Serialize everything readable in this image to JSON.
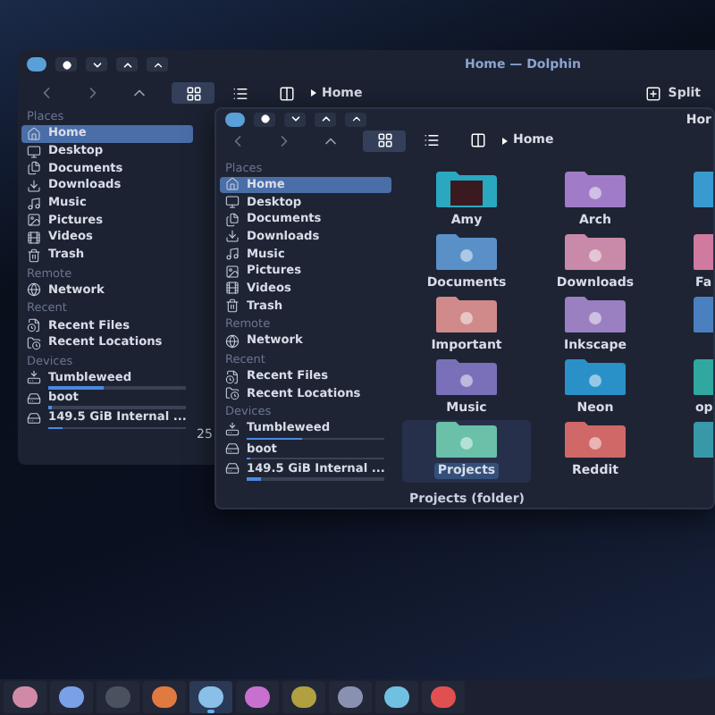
{
  "back_window": {
    "title": "Home — Dolphin",
    "breadcrumb": "Home",
    "split_button": "Split",
    "sidebar": [
      {
        "heading": "Places",
        "items": [
          {
            "label": "Home",
            "kind": "home",
            "selected": true
          },
          {
            "label": "Desktop",
            "kind": "desktop",
            "selected": false
          },
          {
            "label": "Documents",
            "kind": "documents",
            "selected": false
          },
          {
            "label": "Downloads",
            "kind": "downloads",
            "selected": false
          },
          {
            "label": "Music",
            "kind": "music",
            "selected": false
          },
          {
            "label": "Pictures",
            "kind": "pictures",
            "selected": false
          },
          {
            "label": "Videos",
            "kind": "videos",
            "selected": false
          },
          {
            "label": "Trash",
            "kind": "trash",
            "selected": false
          }
        ]
      },
      {
        "heading": "Remote",
        "items": [
          {
            "label": "Network",
            "kind": "network",
            "selected": false
          }
        ]
      },
      {
        "heading": "Recent",
        "items": [
          {
            "label": "Recent Files",
            "kind": "recent-files",
            "selected": false
          },
          {
            "label": "Recent Locations",
            "kind": "recent-locations",
            "selected": false
          }
        ]
      },
      {
        "heading": "Devices",
        "items": [
          {
            "label": "Tumbleweed",
            "kind": "device",
            "selected": false,
            "level": 0.4
          },
          {
            "label": "boot",
            "kind": "drive",
            "selected": false,
            "level": 0.02
          },
          {
            "label": "149.5 GiB Internal ...",
            "kind": "drive",
            "selected": false,
            "level": 0.1
          }
        ]
      }
    ],
    "status": "25"
  },
  "front_window": {
    "title": "Hor",
    "breadcrumb": "Home",
    "sidebar": [
      {
        "heading": "Places",
        "items": [
          {
            "label": "Home",
            "kind": "home",
            "selected": true
          },
          {
            "label": "Desktop",
            "kind": "desktop",
            "selected": false
          },
          {
            "label": "Documents",
            "kind": "documents",
            "selected": false
          },
          {
            "label": "Downloads",
            "kind": "downloads",
            "selected": false
          },
          {
            "label": "Music",
            "kind": "music",
            "selected": false
          },
          {
            "label": "Pictures",
            "kind": "pictures",
            "selected": false
          },
          {
            "label": "Videos",
            "kind": "videos",
            "selected": false
          },
          {
            "label": "Trash",
            "kind": "trash",
            "selected": false
          }
        ]
      },
      {
        "heading": "Remote",
        "items": [
          {
            "label": "Network",
            "kind": "network",
            "selected": false
          }
        ]
      },
      {
        "heading": "Recent",
        "items": [
          {
            "label": "Recent Files",
            "kind": "recent-files",
            "selected": false
          },
          {
            "label": "Recent Locations",
            "kind": "recent-locations",
            "selected": false
          }
        ]
      },
      {
        "heading": "Devices",
        "items": [
          {
            "label": "Tumbleweed",
            "kind": "device",
            "selected": false,
            "level": 0.4
          },
          {
            "label": "boot",
            "kind": "drive",
            "selected": false,
            "level": 0.02
          },
          {
            "label": "149.5 GiB Internal ...",
            "kind": "drive",
            "selected": false,
            "level": 0.1
          }
        ]
      }
    ],
    "files": [
      {
        "name": "Amy",
        "kind": "picture",
        "color": "#2aa8c0",
        "selected": false
      },
      {
        "name": "Arch",
        "kind": "folder",
        "color": "#a07cc8",
        "selected": false
      },
      {
        "kind": "folder",
        "color": "#3a9ad0",
        "selected": false
      },
      {
        "name": "Documents",
        "kind": "folder",
        "color": "#5a90c8",
        "selected": false
      },
      {
        "name": "Downloads",
        "kind": "folder",
        "color": "#c88aa8",
        "selected": false
      },
      {
        "name": "Fa",
        "kind": "folder",
        "color": "#d07aa0",
        "selected": false
      },
      {
        "name": "Important",
        "kind": "folder",
        "color": "#d08a8a",
        "selected": false
      },
      {
        "name": "Inkscape",
        "kind": "folder",
        "color": "#9a80c0",
        "selected": false
      },
      {
        "kind": "folder",
        "color": "#4a80c0",
        "selected": false
      },
      {
        "name": "Music",
        "kind": "folder",
        "color": "#7a70b8",
        "selected": false
      },
      {
        "name": "Neon",
        "kind": "folder",
        "color": "#2a90c8",
        "selected": false
      },
      {
        "name": "op",
        "kind": "folder",
        "color": "#30a8a0",
        "selected": false
      },
      {
        "name": "Projects",
        "kind": "folder",
        "color": "#6ac0a8",
        "selected": true
      },
      {
        "name": "Reddit",
        "kind": "folder",
        "color": "#d06868",
        "selected": false
      },
      {
        "kind": "folder",
        "color": "#3a98a8",
        "selected": false
      }
    ],
    "tooltip": "Projects (folder)"
  },
  "taskbar": {
    "apps": [
      {
        "color": "#d08aa8",
        "selected": false
      },
      {
        "color": "#7aa0e8",
        "selected": false
      },
      {
        "color": "#4a5260",
        "selected": false
      },
      {
        "color": "#e07a40",
        "selected": false
      },
      {
        "color": "#8ac0e8",
        "selected": true
      },
      {
        "color": "#c870d0",
        "selected": false
      },
      {
        "color": "#b0a040",
        "selected": false
      },
      {
        "color": "#8a90b0",
        "selected": false
      },
      {
        "color": "#70c0e0",
        "selected": false
      },
      {
        "color": "#e05050",
        "selected": false
      }
    ]
  }
}
